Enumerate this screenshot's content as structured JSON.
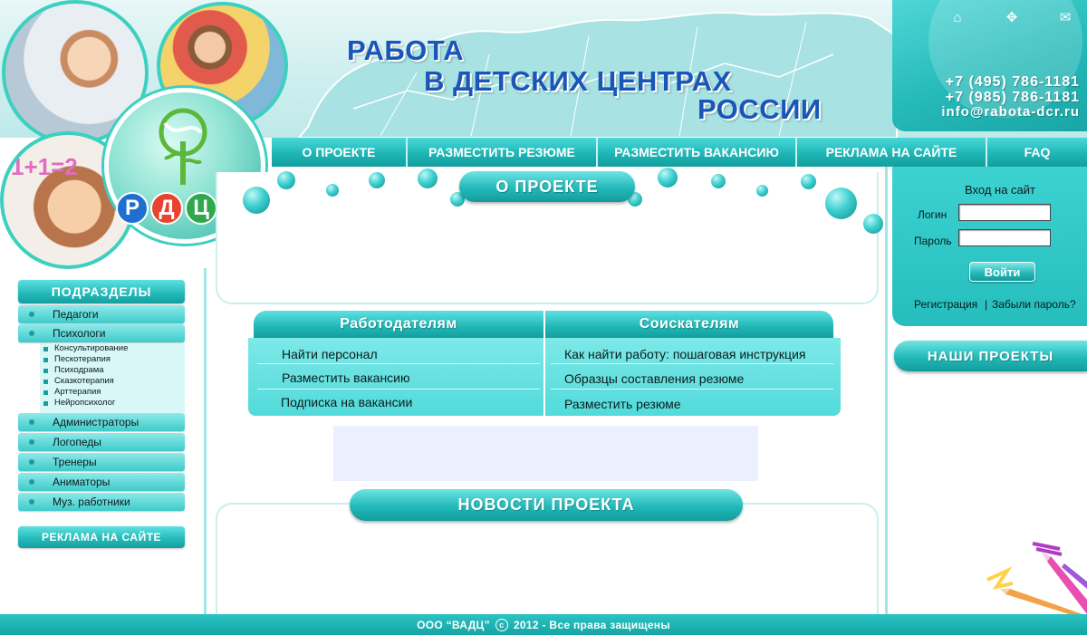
{
  "header": {
    "title_line1": "РАБОТА",
    "title_line2": "В ДЕТСКИХ ЦЕНТРАХ",
    "title_line3": "РОССИИ",
    "phone1": "+7 (495) 786-1181",
    "phone2": "+7 (985) 786-1181",
    "email": "info@rabota-dcr.ru",
    "icons": [
      "home-icon",
      "sitemap-icon",
      "mail-icon"
    ]
  },
  "logo": {
    "letters": [
      "Р",
      "Д",
      "Ц",
      "Р"
    ],
    "letter_colors": [
      "#1f6fd1",
      "#e8432e",
      "#2ea84a",
      "#1f6fd1"
    ]
  },
  "nav": {
    "items": [
      "О ПРОЕКТЕ",
      "РАЗМЕСТИТЬ РЕЗЮМЕ",
      "РАЗМЕСТИТЬ  ВАКАНСИЮ",
      "РЕКЛАМА НА САЙТЕ",
      "FAQ"
    ]
  },
  "sidebar": {
    "heading": "ПОДРАЗДЕЛЫ",
    "categories": [
      "Педагоги",
      "Психологи",
      "Администраторы",
      "Логопеды",
      "Тренеры",
      "Аниматоры",
      "Муз. работники"
    ],
    "psych_subitems": [
      "Консультирование",
      "Пескотерапия",
      "Психодрама",
      "Сказкотерапия",
      "Арттерапия",
      "Нейропсихолог"
    ],
    "ads_button": "РЕКЛАМА НА САЙТЕ"
  },
  "main": {
    "about_heading": "О ПРОЕКТЕ",
    "employers": {
      "heading": "Работодателям",
      "links": [
        "Найти персонал",
        "Разместить вакансию",
        "Подписка на вакансии"
      ]
    },
    "seekers": {
      "heading": "Соискателям",
      "links": [
        "Как найти работу: пошаговая инструкция",
        "Образцы составления резюме",
        "Разместить резюме"
      ]
    },
    "news_heading": "НОВОСТИ ПРОЕКТА"
  },
  "login": {
    "title": "Вход на сайт",
    "login_label": "Логин",
    "password_label": "Пароль",
    "submit": "Войти",
    "register": "Регистрация",
    "separator": "|",
    "forgot": "Забыли пароль?"
  },
  "projects": {
    "heading": "НАШИ ПРОЕКТЫ"
  },
  "footer": {
    "company": "ООО “ВАДЦ”",
    "copyright_symbol": "c",
    "text": "2012 - Все права защищены"
  },
  "colors": {
    "accent": "#22b9b9",
    "title_blue": "#1a56b8"
  }
}
